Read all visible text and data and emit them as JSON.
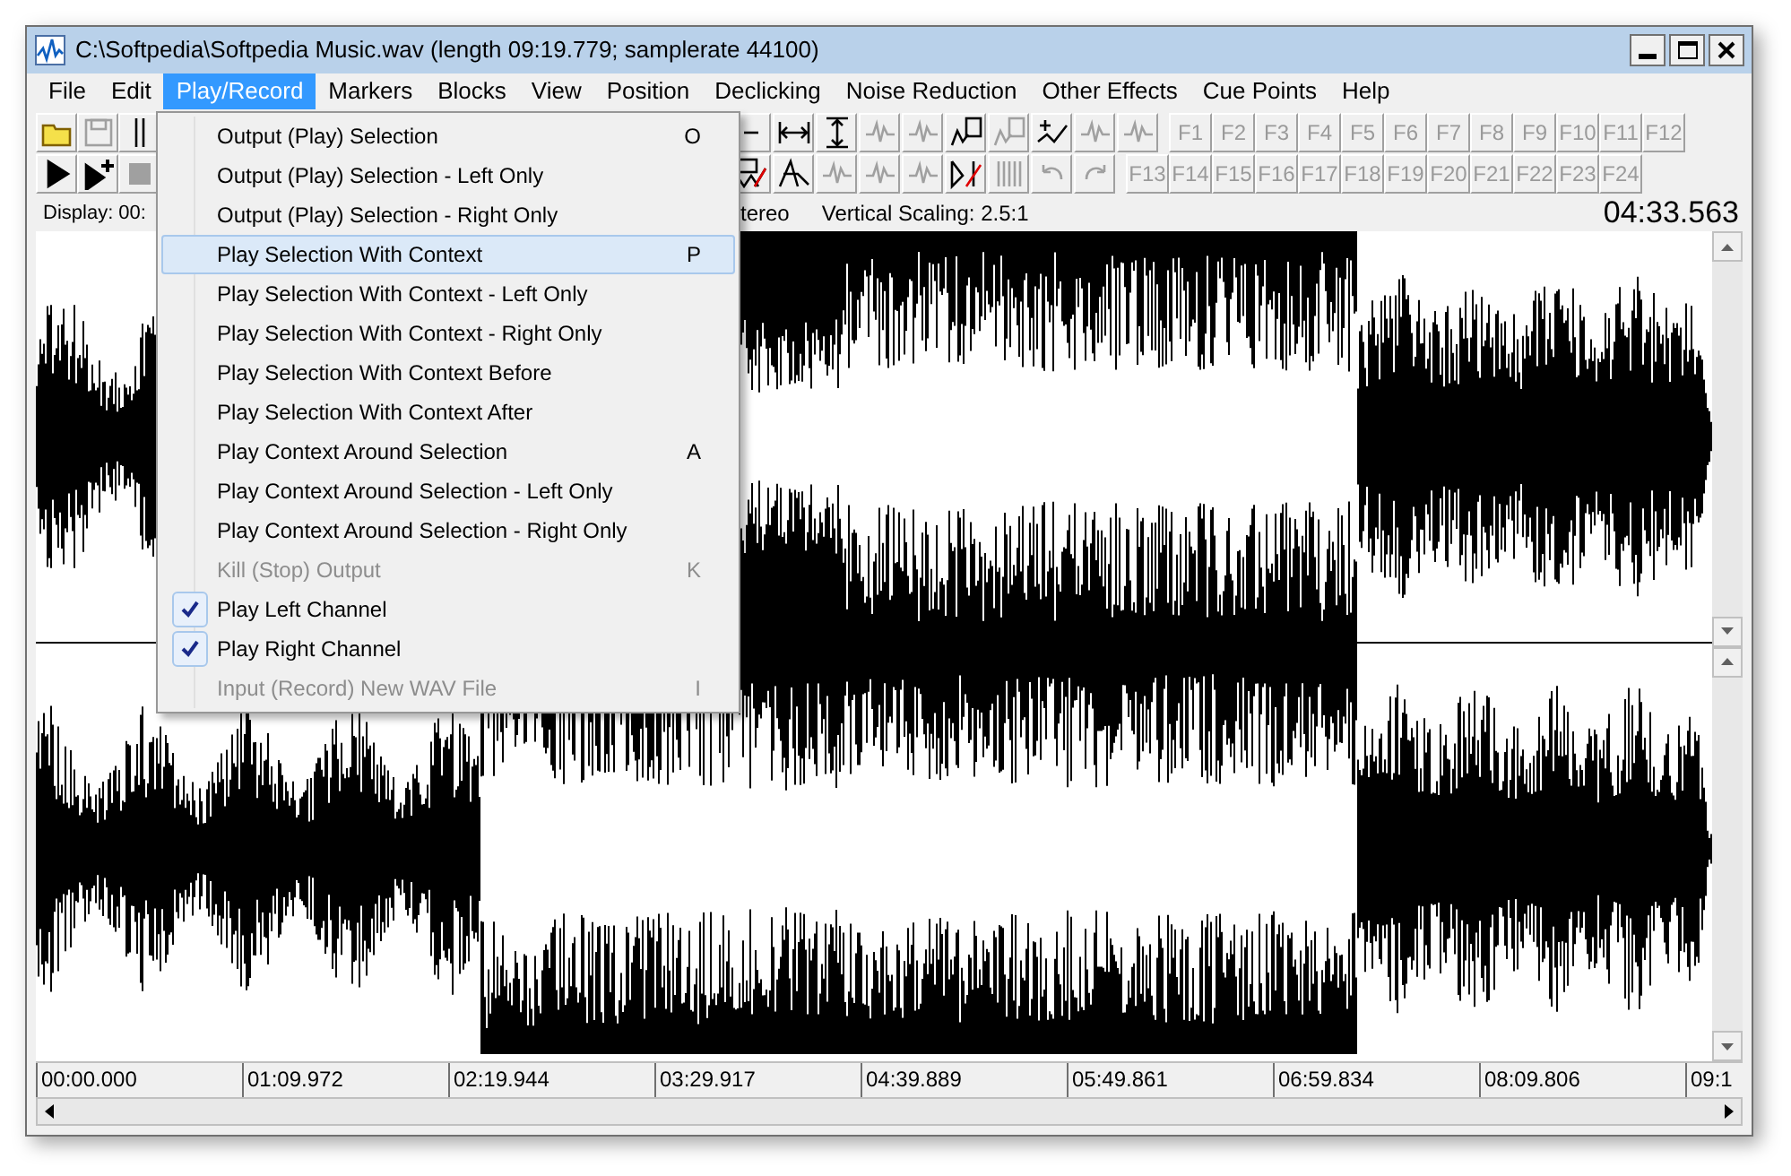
{
  "window": {
    "title": "C:\\Softpedia\\Softpedia Music.wav (length 09:19.779; samplerate 44100)"
  },
  "menu_bar": [
    {
      "label": "File",
      "selected": false
    },
    {
      "label": "Edit",
      "selected": false
    },
    {
      "label": "Play/Record",
      "selected": true
    },
    {
      "label": "Markers",
      "selected": false
    },
    {
      "label": "Blocks",
      "selected": false
    },
    {
      "label": "View",
      "selected": false
    },
    {
      "label": "Position",
      "selected": false
    },
    {
      "label": "Declicking",
      "selected": false
    },
    {
      "label": "Noise Reduction",
      "selected": false
    },
    {
      "label": "Other Effects",
      "selected": false
    },
    {
      "label": "Cue Points",
      "selected": false
    },
    {
      "label": "Help",
      "selected": false
    }
  ],
  "toolbar": {
    "row_1_left": [
      {
        "kind": "folder",
        "disabled": false
      },
      {
        "kind": "save",
        "disabled": true
      },
      {
        "kind": "bars",
        "disabled": false
      }
    ],
    "row_2_left": [
      {
        "kind": "play",
        "disabled": false
      },
      {
        "kind": "playplus",
        "disabled": false
      },
      {
        "kind": "stop",
        "disabled": true
      }
    ],
    "row_1_right": [
      {
        "kind": "partial",
        "disabled": false
      },
      {
        "kind": "hwidth",
        "disabled": false
      },
      {
        "kind": "vheight",
        "disabled": false
      },
      {
        "kind": "wave",
        "disabled": true
      },
      {
        "kind": "wave",
        "disabled": true
      },
      {
        "kind": "clip",
        "disabled": false
      },
      {
        "kind": "clip",
        "disabled": true
      },
      {
        "kind": "waveplus",
        "disabled": false
      },
      {
        "kind": "wave",
        "disabled": true
      },
      {
        "kind": "wave",
        "disabled": true
      }
    ],
    "row_2_right": [
      {
        "kind": "marker",
        "disabled": false
      },
      {
        "kind": "wavetool",
        "disabled": false
      },
      {
        "kind": "wave",
        "disabled": true
      },
      {
        "kind": "wave",
        "disabled": true
      },
      {
        "kind": "wave",
        "disabled": true
      },
      {
        "kind": "cut",
        "disabled": false
      },
      {
        "kind": "comb",
        "disabled": true
      },
      {
        "kind": "undo",
        "disabled": true
      },
      {
        "kind": "redo",
        "disabled": true
      }
    ],
    "function_keys_1": [
      {
        "label": "F1",
        "disabled": true
      },
      {
        "label": "F2",
        "disabled": true
      },
      {
        "label": "F3",
        "disabled": true
      },
      {
        "label": "F4",
        "disabled": true
      },
      {
        "label": "F5",
        "disabled": true
      },
      {
        "label": "F6",
        "disabled": true
      },
      {
        "label": "F7",
        "disabled": true
      },
      {
        "label": "F8",
        "disabled": true
      },
      {
        "label": "F9",
        "disabled": true
      },
      {
        "label": "F10",
        "disabled": true
      },
      {
        "label": "F11",
        "disabled": true
      },
      {
        "label": "F12",
        "disabled": true
      }
    ],
    "function_keys_2": [
      {
        "label": "F13",
        "disabled": true
      },
      {
        "label": "F14",
        "disabled": true
      },
      {
        "label": "F15",
        "disabled": true
      },
      {
        "label": "F16",
        "disabled": true
      },
      {
        "label": "F17",
        "disabled": true
      },
      {
        "label": "F18",
        "disabled": true
      },
      {
        "label": "F19",
        "disabled": true
      },
      {
        "label": "F20",
        "disabled": true
      },
      {
        "label": "F21",
        "disabled": true
      },
      {
        "label": "F22",
        "disabled": true
      },
      {
        "label": "F23",
        "disabled": true
      },
      {
        "label": "F24",
        "disabled": true
      }
    ]
  },
  "status_bar": {
    "display": "Display: 00:",
    "channels": "tereo",
    "vertical_scaling": "Vertical Scaling: 2.5:1",
    "position": "04:33.563"
  },
  "menu": [
    {
      "label": "Output (Play) Selection",
      "shortcut": "O",
      "disabled": false,
      "checked": false,
      "selected": false
    },
    {
      "label": "Output (Play) Selection - Left Only",
      "disabled": false,
      "checked": false,
      "selected": false
    },
    {
      "label": "Output (Play) Selection - Right Only",
      "disabled": false,
      "checked": false,
      "selected": false
    },
    {
      "label": "Play Selection With Context",
      "shortcut": "P",
      "disabled": false,
      "checked": false,
      "selected": true
    },
    {
      "label": "Play Selection With Context - Left Only",
      "disabled": false,
      "checked": false,
      "selected": false
    },
    {
      "label": "Play Selection With Context - Right Only",
      "disabled": false,
      "checked": false,
      "selected": false
    },
    {
      "label": "Play Selection With Context Before",
      "disabled": false,
      "checked": false,
      "selected": false
    },
    {
      "label": "Play Selection With Context After",
      "disabled": false,
      "checked": false,
      "selected": false
    },
    {
      "label": "Play Context Around Selection",
      "shortcut": "A",
      "disabled": false,
      "checked": false,
      "selected": false
    },
    {
      "label": "Play Context Around Selection - Left Only",
      "disabled": false,
      "checked": false,
      "selected": false
    },
    {
      "label": "Play Context Around Selection - Right Only",
      "disabled": false,
      "checked": false,
      "selected": false
    },
    {
      "label": "Kill (Stop) Output",
      "shortcut": "K",
      "disabled": true,
      "checked": false,
      "selected": false
    },
    {
      "label": "Play Left Channel",
      "disabled": false,
      "checked": true,
      "selected": false
    },
    {
      "label": "Play Right Channel",
      "disabled": false,
      "checked": true,
      "selected": false
    },
    {
      "label": "Input (Record) New WAV File",
      "shortcut": "I",
      "disabled": true,
      "checked": false,
      "selected": false
    }
  ],
  "time_ruler": [
    "00:00.000",
    "01:09.972",
    "02:19.944",
    "03:29.917",
    "04:39.889",
    "05:49.861",
    "06:59.834",
    "08:09.806",
    "09:1"
  ]
}
